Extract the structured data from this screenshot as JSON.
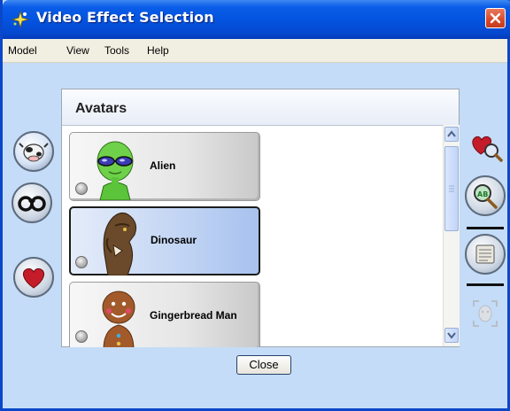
{
  "window": {
    "title": "Video Effect Selection",
    "app_icon": "sparkle-app-icon",
    "close_icon": "close-x-icon"
  },
  "menubar": {
    "items": [
      "Model",
      "View",
      "Tools",
      "Help"
    ]
  },
  "panel": {
    "title": "Avatars",
    "items": [
      {
        "label": "Alien",
        "icon": "alien-avatar-icon",
        "selected": false
      },
      {
        "label": "Dinosaur",
        "icon": "dinosaur-avatar-icon",
        "selected": true
      },
      {
        "label": "Gingerbread Man",
        "icon": "gingerbread-avatar-icon",
        "selected": false
      }
    ]
  },
  "left_tabs": [
    {
      "icon": "cow-icon"
    },
    {
      "icon": "glasses-icon"
    },
    {
      "icon": "heart-icon"
    }
  ],
  "right_tools": [
    {
      "icon": "heart-search-icon"
    },
    {
      "icon": "abc-search-icon"
    },
    {
      "icon": "document-icon"
    },
    {
      "icon": "face-frame-icon"
    }
  ],
  "footer": {
    "close_label": "Close"
  },
  "colors": {
    "titlebar": "#0454e0",
    "body": "#c4dcf7",
    "selected_item": "#c4d6f4",
    "close_button": "#d8492a"
  }
}
